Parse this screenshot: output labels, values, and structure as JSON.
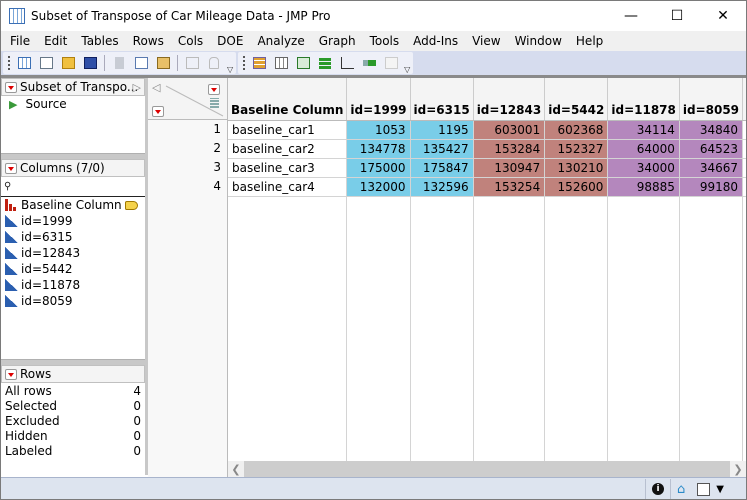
{
  "window": {
    "title": "Subset of Transpose of Car Mileage Data - JMP Pro",
    "controls": {
      "minimize": "—",
      "maximize": "☐",
      "close": "✕"
    }
  },
  "menu": [
    "File",
    "Edit",
    "Tables",
    "Rows",
    "Cols",
    "DOE",
    "Analyze",
    "Graph",
    "Tools",
    "Add-Ins",
    "View",
    "Window",
    "Help"
  ],
  "toolbar": {
    "group1": [
      "new-data-table-icon",
      "new-script-icon",
      "open-folder-icon",
      "save-icon",
      "cut-icon",
      "copy-icon",
      "paste-icon",
      "subset-icon",
      "lock-icon"
    ],
    "group2": [
      "data-table-icon",
      "column-info-icon",
      "table-layout-icon",
      "distribution-icon",
      "fit-y-by-x-icon",
      "fit-model-icon",
      "edit-script-icon"
    ]
  },
  "tables_panel": {
    "title": "Subset of Transpo...",
    "items": [
      {
        "label": "Source",
        "icon": "play-icon"
      }
    ]
  },
  "columns_panel": {
    "title": "Columns (7/0)",
    "search_placeholder": "",
    "items": [
      {
        "label": "Baseline Column",
        "type": "nominal",
        "tagged": true
      },
      {
        "label": "id=1999",
        "type": "continuous"
      },
      {
        "label": "id=6315",
        "type": "continuous"
      },
      {
        "label": "id=12843",
        "type": "continuous"
      },
      {
        "label": "id=5442",
        "type": "continuous"
      },
      {
        "label": "id=11878",
        "type": "continuous"
      },
      {
        "label": "id=8059",
        "type": "continuous"
      }
    ]
  },
  "rows_panel": {
    "title": "Rows",
    "stats": [
      {
        "label": "All rows",
        "value": "4"
      },
      {
        "label": "Selected",
        "value": "0"
      },
      {
        "label": "Excluded",
        "value": "0"
      },
      {
        "label": "Hidden",
        "value": "0"
      },
      {
        "label": "Labeled",
        "value": "0"
      }
    ]
  },
  "table": {
    "headers": [
      "Baseline Column",
      "id=1999",
      "id=6315",
      "id=12843",
      "id=5442",
      "id=11878",
      "id=8059"
    ],
    "colors": [
      "#ffffff",
      "#79cde8",
      "#79cde8",
      "#c0827c",
      "#c0827c",
      "#b487bd",
      "#b487bd"
    ],
    "row_numbers": [
      "1",
      "2",
      "3",
      "4"
    ],
    "rows": [
      [
        "baseline_car1",
        "1053",
        "1195",
        "603001",
        "602368",
        "34114",
        "34840"
      ],
      [
        "baseline_car2",
        "134778",
        "135427",
        "153284",
        "152327",
        "64000",
        "64523"
      ],
      [
        "baseline_car3",
        "175000",
        "175847",
        "130947",
        "130210",
        "34000",
        "34667"
      ],
      [
        "baseline_car4",
        "132000",
        "132596",
        "153254",
        "152600",
        "98885",
        "99180"
      ]
    ]
  },
  "statusbar": {
    "icons": [
      "info-icon",
      "home-icon",
      "window-checkbox",
      "dropdown-icon"
    ]
  }
}
